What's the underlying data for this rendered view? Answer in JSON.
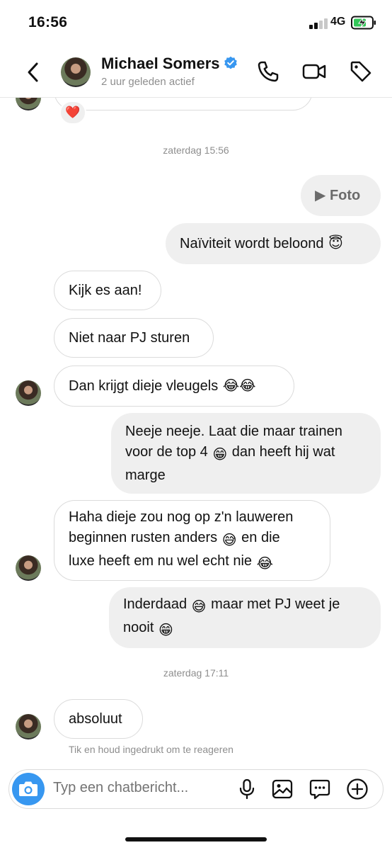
{
  "status_bar": {
    "time": "16:56",
    "network": "4G"
  },
  "header": {
    "contact_name": "Michael Somers",
    "contact_status": "2 uur geleden actief"
  },
  "reaction": "❤️",
  "messages": [
    {
      "type": "timestamp",
      "text": "zaterdag 15:56"
    },
    {
      "type": "outgoing",
      "text": "▶ Foto"
    },
    {
      "type": "outgoing",
      "text": "Naïviteit wordt beloond",
      "emoji": "😇"
    },
    {
      "type": "incoming",
      "text": "Kijk es aan!"
    },
    {
      "type": "incoming",
      "text": "Niet naar PJ sturen"
    },
    {
      "type": "incoming",
      "text": "Dan krijgt dieje vleugels",
      "emoji": "😂😂"
    },
    {
      "type": "outgoing",
      "line1": "Neeje neeje. Laat die maar trainen",
      "line2a": "voor de top 4",
      "emoji": "😁",
      "line2b": "dan heeft hij wat",
      "line3": "marge"
    },
    {
      "type": "incoming",
      "line1": "Haha dieje zou nog op z'n lauweren",
      "line2a": "beginnen rusten anders",
      "emoji1": "😅",
      "line2b": "en die",
      "line3": "luxe heeft em nu wel echt nie",
      "emoji2": "😂"
    },
    {
      "type": "outgoing",
      "line1a": "Inderdaad",
      "emoji1": "😅",
      "line1b": "maar met PJ weet je",
      "line2": "nooit",
      "emoji2": "😁"
    },
    {
      "type": "timestamp",
      "text": "zaterdag 17:11"
    },
    {
      "type": "incoming",
      "text": "absoluut"
    }
  ],
  "hint": "Tik en houd ingedrukt om te reageren",
  "composer": {
    "placeholder": "Typ een chatbericht..."
  },
  "colors": {
    "accent_blue": "#3797f0",
    "verified_blue": "#3897f0",
    "outgoing_bg": "#efefef"
  },
  "icons": [
    "chevron-left-icon",
    "verified-badge-icon",
    "phone-icon",
    "video-camera-icon",
    "tag-icon",
    "camera-icon",
    "microphone-icon",
    "image-icon",
    "sticker-chat-icon",
    "plus-circle-icon"
  ]
}
